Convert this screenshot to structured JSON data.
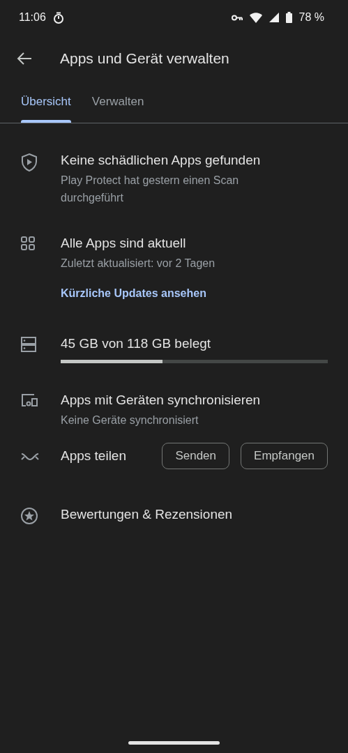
{
  "status_bar": {
    "time": "11:06",
    "battery": "78 %"
  },
  "header": {
    "title": "Apps und Gerät verwalten"
  },
  "tabs": [
    {
      "label": "Übersicht",
      "selected": true
    },
    {
      "label": "Verwalten",
      "selected": false
    }
  ],
  "items": [
    {
      "kind": "protect",
      "title": "Keine schädlichen Apps gefunden",
      "subtitle": "Play Protect hat gestern einen Scan durchgeführt"
    },
    {
      "kind": "updates",
      "title": "Alle Apps sind aktuell",
      "subtitle": "Zuletzt aktualisiert: vor 2 Tagen",
      "link": "Kürzliche Updates ansehen"
    },
    {
      "kind": "storage",
      "title": "45 GB von 118 GB belegt",
      "level": 0.38
    },
    {
      "kind": "sync",
      "title": "Apps mit Geräten synchronisieren",
      "subtitle": "Keine Geräte synchronisiert"
    },
    {
      "kind": "share",
      "title": "Apps teilen",
      "buttons": [
        "Senden",
        "Empfangen"
      ]
    },
    {
      "kind": "reviews",
      "title": "Bewertungen & Rezensionen"
    }
  ]
}
